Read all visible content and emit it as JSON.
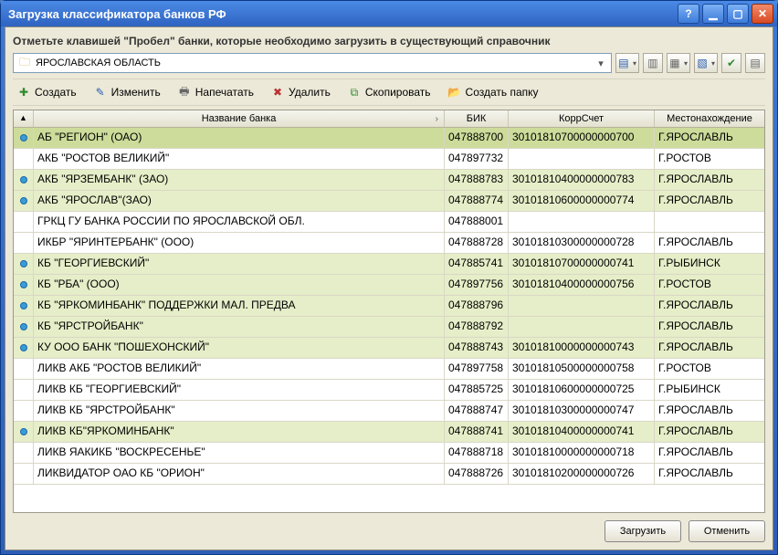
{
  "window": {
    "title": "Загрузка классификатора банков РФ"
  },
  "instruction": "Отметьте клавишей \"Пробел\" банки, которые необходимо загрузить в существующий справочник",
  "region": "ЯРОСЛАВСКАЯ ОБЛАСТЬ",
  "toolbar": {
    "create": "Создать",
    "edit": "Изменить",
    "print": "Напечатать",
    "delete": "Удалить",
    "copy": "Скопировать",
    "create_folder": "Создать папку"
  },
  "columns": {
    "name": "Название банка",
    "bik": "БИК",
    "korr": "КоррСчет",
    "location": "Местонахождение"
  },
  "rows": [
    {
      "mark": true,
      "sel": true,
      "name": "АБ \"РЕГИОН\" (ОАО)",
      "bik": "047888700",
      "korr": "30101810700000000700",
      "loc": "Г.ЯРОСЛАВЛЬ"
    },
    {
      "mark": false,
      "name": "АКБ \"РОСТОВ ВЕЛИКИЙ\"",
      "bik": "047897732",
      "korr": "",
      "loc": "Г.РОСТОВ"
    },
    {
      "mark": true,
      "name": "АКБ \"ЯРЗЕМБАНК\" (ЗАО)",
      "bik": "047888783",
      "korr": "30101810400000000783",
      "loc": "Г.ЯРОСЛАВЛЬ"
    },
    {
      "mark": true,
      "name": "АКБ \"ЯРОСЛАВ\"(ЗАО)",
      "bik": "047888774",
      "korr": "30101810600000000774",
      "loc": "Г.ЯРОСЛАВЛЬ"
    },
    {
      "mark": false,
      "name": "ГРКЦ ГУ БАНКА РОССИИ ПО ЯРОСЛАВСКОЙ ОБЛ.",
      "bik": "047888001",
      "korr": "",
      "loc": ""
    },
    {
      "mark": false,
      "name": "ИКБР \"ЯРИНТЕРБАНК\" (ООО)",
      "bik": "047888728",
      "korr": "30101810300000000728",
      "loc": "Г.ЯРОСЛАВЛЬ"
    },
    {
      "mark": true,
      "name": "КБ \"ГЕОРГИЕВСКИЙ\"",
      "bik": "047885741",
      "korr": "30101810700000000741",
      "loc": "Г.РЫБИНСК"
    },
    {
      "mark": true,
      "name": "КБ \"РБА\" (ООО)",
      "bik": "047897756",
      "korr": "30101810400000000756",
      "loc": "Г.РОСТОВ"
    },
    {
      "mark": true,
      "name": "КБ \"ЯРКОМИНБАНК\" ПОДДЕРЖКИ МАЛ. ПРЕДВА",
      "bik": "047888796",
      "korr": "",
      "loc": "Г.ЯРОСЛАВЛЬ"
    },
    {
      "mark": true,
      "name": "КБ \"ЯРСТРОЙБАНК\"",
      "bik": "047888792",
      "korr": "",
      "loc": "Г.ЯРОСЛАВЛЬ"
    },
    {
      "mark": true,
      "name": "КУ ООО БАНК \"ПОШЕХОНСКИЙ\"",
      "bik": "047888743",
      "korr": "30101810000000000743",
      "loc": "Г.ЯРОСЛАВЛЬ"
    },
    {
      "mark": false,
      "name": "ЛИКВ АКБ \"РОСТОВ ВЕЛИКИЙ\"",
      "bik": "047897758",
      "korr": "30101810500000000758",
      "loc": "Г.РОСТОВ"
    },
    {
      "mark": false,
      "name": "ЛИКВ КБ \"ГЕОРГИЕВСКИЙ\"",
      "bik": "047885725",
      "korr": "30101810600000000725",
      "loc": "Г.РЫБИНСК"
    },
    {
      "mark": false,
      "name": "ЛИКВ КБ \"ЯРСТРОЙБАНК\"",
      "bik": "047888747",
      "korr": "30101810300000000747",
      "loc": "Г.ЯРОСЛАВЛЬ"
    },
    {
      "mark": true,
      "name": "ЛИКВ КБ\"ЯРКОМИНБАНК\"",
      "bik": "047888741",
      "korr": "30101810400000000741",
      "loc": "Г.ЯРОСЛАВЛЬ"
    },
    {
      "mark": false,
      "name": "ЛИКВ ЯАКИКБ \"ВОСКРЕСЕНЬЕ\"",
      "bik": "047888718",
      "korr": "30101810000000000718",
      "loc": "Г.ЯРОСЛАВЛЬ"
    },
    {
      "mark": false,
      "name": "ЛИКВИДАТОР ОАО КБ \"ОРИОН\"",
      "bik": "047888726",
      "korr": "30101810200000000726",
      "loc": "Г.ЯРОСЛАВЛЬ"
    }
  ],
  "buttons": {
    "load": "Загрузить",
    "cancel": "Отменить"
  }
}
